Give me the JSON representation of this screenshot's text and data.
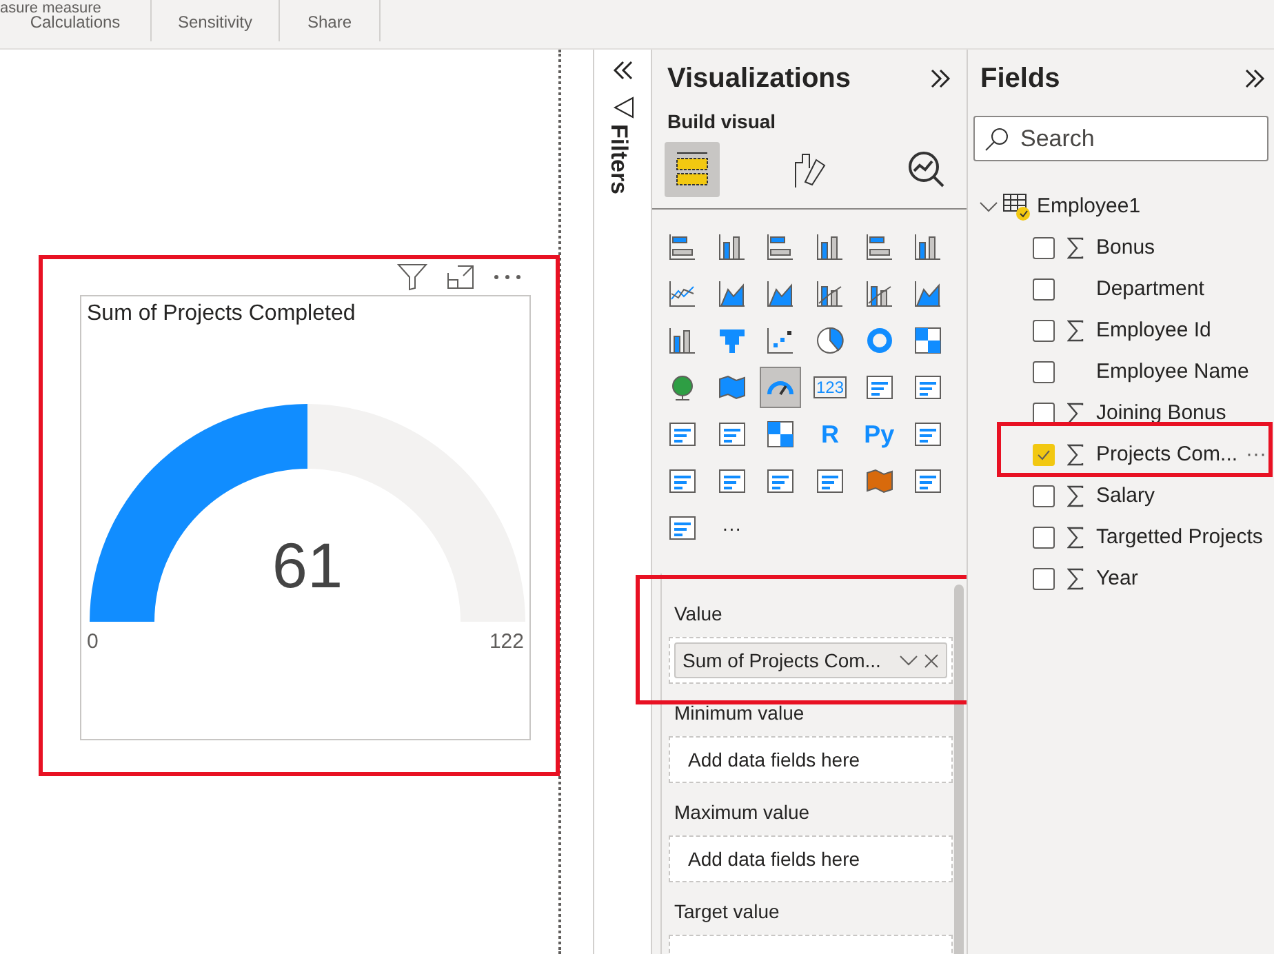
{
  "ribbon": {
    "cut_text": "asure measure",
    "groups": [
      "Calculations",
      "Sensitivity",
      "Share"
    ]
  },
  "canvas": {
    "visual": {
      "title": "Sum of Projects Completed",
      "value": "61",
      "min": "0",
      "max": "122",
      "level": 0.5
    }
  },
  "filters": {
    "label": "Filters"
  },
  "visualizations": {
    "title": "Visualizations",
    "subtitle": "Build visual",
    "build_tabs": [
      {
        "selected": true
      },
      {
        "selected": false
      },
      {
        "selected": false
      }
    ],
    "visual_types": [
      {
        "selected": false
      },
      {
        "selected": false
      },
      {
        "selected": false
      },
      {
        "selected": false
      },
      {
        "selected": false
      },
      {
        "selected": false
      },
      {
        "selected": false
      },
      {
        "selected": false
      },
      {
        "selected": false
      },
      {
        "selected": false
      },
      {
        "selected": false
      },
      {
        "selected": false
      },
      {
        "selected": false
      },
      {
        "selected": false
      },
      {
        "selected": false
      },
      {
        "selected": false
      },
      {
        "selected": false
      },
      {
        "selected": false
      },
      {
        "selected": false
      },
      {
        "selected": false
      },
      {
        "selected": true
      },
      {
        "selected": false
      },
      {
        "selected": false
      },
      {
        "selected": false
      },
      {
        "selected": false
      },
      {
        "selected": false
      },
      {
        "selected": false
      },
      {
        "selected": false
      },
      {
        "selected": false
      },
      {
        "selected": false
      },
      {
        "selected": false
      },
      {
        "selected": false
      },
      {
        "selected": false
      },
      {
        "selected": false
      },
      {
        "selected": false
      },
      {
        "selected": false
      },
      {
        "selected": false
      }
    ],
    "text_icons": [
      "123",
      "R",
      "Py"
    ],
    "more": "···",
    "wells": [
      {
        "label": "Value",
        "chip": "Sum of Projects Com..."
      },
      {
        "label": "Minimum value",
        "placeholder": "Add data fields here"
      },
      {
        "label": "Maximum value",
        "placeholder": "Add data fields here"
      },
      {
        "label": "Target value"
      }
    ]
  },
  "fields": {
    "title": "Fields",
    "search": {
      "placeholder": "Search"
    },
    "tables": [
      {
        "name": "Employee1",
        "expanded": true,
        "children": [
          {
            "name": "Bonus",
            "sum": true,
            "checked": false
          },
          {
            "name": "Department",
            "sum": false,
            "checked": false
          },
          {
            "name": "Employee Id",
            "sum": true,
            "checked": false
          },
          {
            "name": "Employee Name",
            "sum": false,
            "checked": false
          },
          {
            "name": "Joining Bonus",
            "sum": true,
            "checked": false
          },
          {
            "name": "Projects Com...",
            "sum": true,
            "checked": true,
            "menu": "···"
          },
          {
            "name": "Salary",
            "sum": true,
            "checked": false
          },
          {
            "name": "Targetted Projects",
            "sum": true,
            "checked": false
          },
          {
            "name": "Year",
            "sum": true,
            "checked": false
          }
        ]
      }
    ]
  }
}
